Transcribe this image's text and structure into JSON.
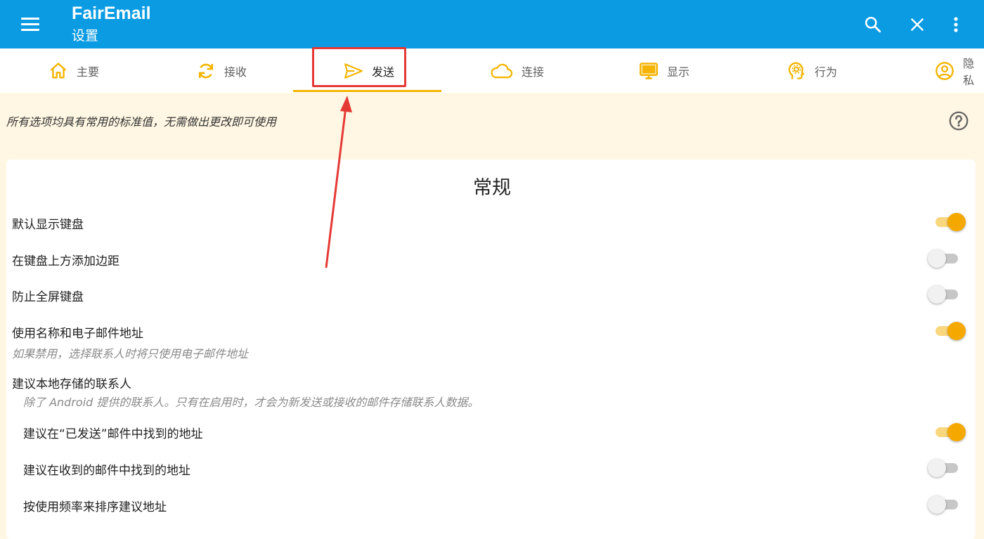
{
  "app": {
    "title": "FairEmail",
    "subtitle": "设置"
  },
  "tabs": [
    {
      "label": "主要",
      "icon": "home-icon"
    },
    {
      "label": "接收",
      "icon": "sync-icon"
    },
    {
      "label": "发送",
      "icon": "send-icon",
      "active": true
    },
    {
      "label": "连接",
      "icon": "cloud-icon"
    },
    {
      "label": "显示",
      "icon": "monitor-icon"
    },
    {
      "label": "行为",
      "icon": "head-gear-icon"
    },
    {
      "label": "隐私",
      "icon": "account-icon"
    }
  ],
  "hint": "所有选项均具有常用的标准值，无需做出更改即可使用",
  "section": {
    "title": "常规"
  },
  "settings": [
    {
      "label": "默认显示键盘",
      "enabled": true
    },
    {
      "label": "在键盘上方添加边距",
      "enabled": false
    },
    {
      "label": "防止全屏键盘",
      "enabled": false
    },
    {
      "label": "使用名称和电子邮件地址",
      "enabled": true,
      "description": "如果禁用，选择联系人时将只使用电子邮件地址"
    },
    {
      "label": "建议本地存储的联系人",
      "description": "除了 Android 提供的联系人。只有在启用时，才会为新发送或接收的邮件存储联系人数据。"
    },
    {
      "label": "建议在“已发送”邮件中找到的地址",
      "enabled": true
    },
    {
      "label": "建议在收到的邮件中找到的地址",
      "enabled": false
    },
    {
      "label": "按使用频率来排序建议地址",
      "enabled": false
    }
  ],
  "colors": {
    "appbar": "#0a9be3",
    "accent": "#f5a900",
    "annotation": "#e53935"
  }
}
